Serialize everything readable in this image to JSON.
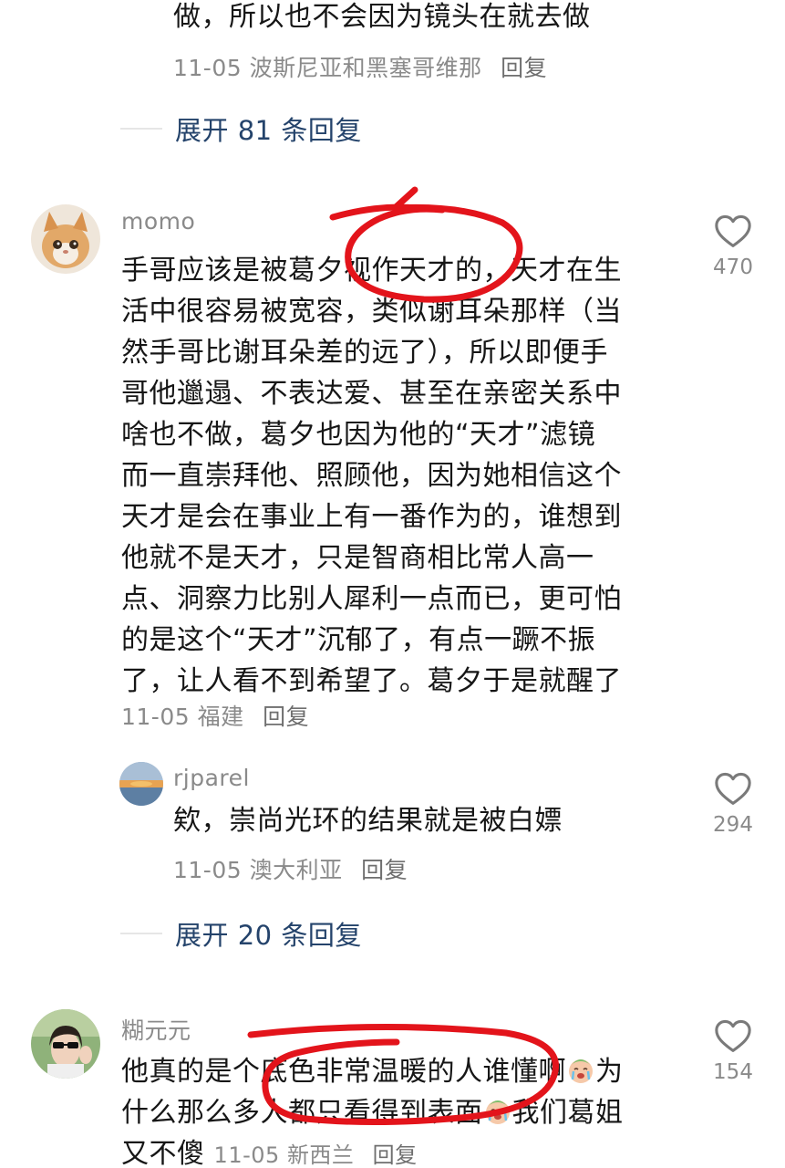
{
  "top_reply": {
    "text_tail": "做，所以也不会因为镜头在就去做",
    "date": "11-05",
    "location": "波斯尼亚和黑塞哥维那",
    "reply_label": "回复"
  },
  "expand_1": {
    "label": "展开 81 条回复"
  },
  "comment_1": {
    "username": "momo",
    "lines": [
      "手哥应该是被葛夕视作天才的，天才在生",
      "活中很容易被宽容，类似谢耳朵那样（当",
      "然手哥比谢耳朵差的远了），所以即便手",
      "哥他邋遢、不表达爱、甚至在亲密关系中",
      "啥也不做，葛夕也因为他的“天才”滤镜",
      "而一直崇拜他、照顾他，因为她相信这个",
      "天才是会在事业上有一番作为的，谁想到",
      "他就不是天才，只是智商相比常人高一",
      "点、洞察力比别人犀利一点而已，更可怕",
      "的是这个“天才”沉郁了，有点一蹶不振",
      "了，让人看不到希望了。葛夕于是就醒了"
    ],
    "date": "11-05",
    "location": "福建",
    "reply_label": "回复",
    "likes": "470"
  },
  "reply_1": {
    "username": "rjparel",
    "text": "欸，崇尚光环的结果就是被白嫖",
    "date": "11-05",
    "location": "澳大利亚",
    "reply_label": "回复",
    "likes": "294"
  },
  "expand_2": {
    "label": "展开 20 条回复"
  },
  "comment_2": {
    "username": "糊元元",
    "line1_a": "他真的是个底色非常温暖的人谁懂啊",
    "line1_b": "为",
    "line2_a": "什么那么多人都只看得到表面",
    "line2_b": "我们葛姐",
    "line3": "又不傻",
    "date": "11-05",
    "location": "新西兰",
    "reply_label": "回复",
    "likes": "154"
  },
  "colors": {
    "expand_link": "#24436b",
    "meta_text": "#8a8a8a",
    "annotation_red": "#e3141b"
  },
  "icons": [
    "heart-outline-icon",
    "crying-face-emoji"
  ]
}
